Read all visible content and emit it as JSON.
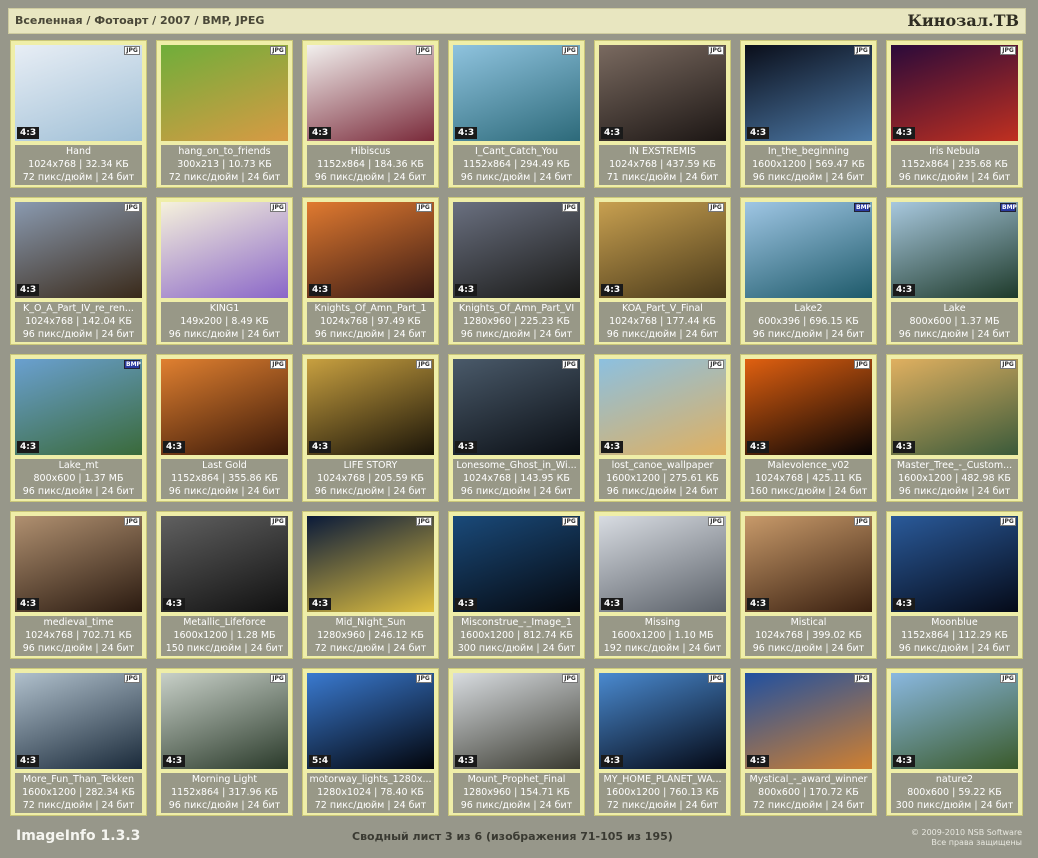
{
  "header": {
    "breadcrumb": "Вселенная / Фотоарт / 2007 / BMP, JPEG",
    "brand": "Кинозал.ТВ"
  },
  "footer": {
    "app_name": "ImageInfo 1.3.3",
    "sheet_info": "Сводный лист 3 из 6 (изображения 71-105 из 195)",
    "copyright": "© 2009-2010 NSB Software",
    "rights": "Все права защищены"
  },
  "items": [
    {
      "name": "Hand",
      "dims": "1024x768 | 32.34 КБ",
      "meta": "72 пикс/дюйм | 24 бит",
      "ratio": "4:3",
      "format": "JPG",
      "colors": [
        "#e8eef5",
        "#9fbfd6"
      ]
    },
    {
      "name": "hang_on_to_friends",
      "dims": "300x213 | 10.73 КБ",
      "meta": "72 пикс/дюйм | 24 бит",
      "ratio": "",
      "format": "JPG",
      "colors": [
        "#6fae3a",
        "#d89a44"
      ]
    },
    {
      "name": "Hibiscus",
      "dims": "1152x864 | 184.36 КБ",
      "meta": "96 пикс/дюйм | 24 бит",
      "ratio": "4:3",
      "format": "JPG",
      "colors": [
        "#f2f0ee",
        "#7a2a3a"
      ]
    },
    {
      "name": "I_Cant_Catch_You",
      "dims": "1152x864 | 294.49 КБ",
      "meta": "96 пикс/дюйм | 24 бит",
      "ratio": "4:3",
      "format": "JPG",
      "colors": [
        "#8fc3de",
        "#2d6a7a"
      ]
    },
    {
      "name": "IN EXSTREMIS",
      "dims": "1024x768 | 437.59 КБ",
      "meta": "71 пикс/дюйм | 24 бит",
      "ratio": "4:3",
      "format": "JPG",
      "colors": [
        "#7a6a60",
        "#1c1614"
      ]
    },
    {
      "name": "In_the_beginning",
      "dims": "1600x1200 | 569.47 КБ",
      "meta": "96 пикс/дюйм | 24 бит",
      "ratio": "4:3",
      "format": "JPG",
      "colors": [
        "#0a0e1a",
        "#4d7aa8"
      ]
    },
    {
      "name": "Iris Nebula",
      "dims": "1152x864 | 235.68 КБ",
      "meta": "96 пикс/дюйм | 24 бит",
      "ratio": "4:3",
      "format": "JPG",
      "colors": [
        "#2a0a3a",
        "#c03020"
      ]
    },
    {
      "name": "K_O_A_Part_IV_re_ren...",
      "dims": "1024x768 | 142.04 КБ",
      "meta": "96 пикс/дюйм | 24 бит",
      "ratio": "4:3",
      "format": "JPG",
      "colors": [
        "#8a9ab0",
        "#3a2a1a"
      ]
    },
    {
      "name": "KING1",
      "dims": "149x200 | 8.49 КБ",
      "meta": "96 пикс/дюйм | 24 бит",
      "ratio": "",
      "format": "JPG",
      "colors": [
        "#f6f2dc",
        "#8a66c8"
      ]
    },
    {
      "name": "Knights_Of_Amn_Part_1",
      "dims": "1024x768 | 97.49 КБ",
      "meta": "96 пикс/дюйм | 24 бит",
      "ratio": "4:3",
      "format": "JPG",
      "colors": [
        "#e07a30",
        "#3a1a14"
      ]
    },
    {
      "name": "Knights_Of_Amn_Part_VI",
      "dims": "1280x960 | 225.23 КБ",
      "meta": "96 пикс/дюйм | 24 бит",
      "ratio": "4:3",
      "format": "JPG",
      "colors": [
        "#6a7080",
        "#1a1a18"
      ]
    },
    {
      "name": "KOA_Part_V_Final",
      "dims": "1024x768 | 177.44 КБ",
      "meta": "96 пикс/дюйм | 24 бит",
      "ratio": "4:3",
      "format": "JPG",
      "colors": [
        "#c8a050",
        "#4a3a1a"
      ]
    },
    {
      "name": "Lake2",
      "dims": "600x396 | 696.15 КБ",
      "meta": "96 пикс/дюйм | 24 бит",
      "ratio": "",
      "format": "BMP",
      "colors": [
        "#9fc6e4",
        "#1e5a6a"
      ]
    },
    {
      "name": "Lake",
      "dims": "800x600 | 1.37 МБ",
      "meta": "96 пикс/дюйм | 24 бит",
      "ratio": "4:3",
      "format": "BMP",
      "colors": [
        "#a8c8de",
        "#1e3a2a"
      ]
    },
    {
      "name": "Lake_mt",
      "dims": "800x600 | 1.37 МБ",
      "meta": "96 пикс/дюйм | 24 бит",
      "ratio": "4:3",
      "format": "BMP",
      "colors": [
        "#6aa0d0",
        "#3a6a3a"
      ]
    },
    {
      "name": "Last Gold",
      "dims": "1152x864 | 355.86 КБ",
      "meta": "96 пикс/дюйм | 24 бит",
      "ratio": "4:3",
      "format": "JPG",
      "colors": [
        "#e08030",
        "#3a1808"
      ]
    },
    {
      "name": "LIFE STORY",
      "dims": "1024x768 | 205.59 КБ",
      "meta": "96 пикс/дюйм | 24 бит",
      "ratio": "4:3",
      "format": "JPG",
      "colors": [
        "#c8a040",
        "#1a1408"
      ]
    },
    {
      "name": "Lonesome_Ghost_in_Wi...",
      "dims": "1024x768 | 143.95 КБ",
      "meta": "96 пикс/дюйм | 24 бит",
      "ratio": "4:3",
      "format": "JPG",
      "colors": [
        "#4a5a6a",
        "#0a0e14"
      ]
    },
    {
      "name": "lost_canoe_wallpaper",
      "dims": "1600x1200 | 275.61 КБ",
      "meta": "96 пикс/дюйм | 24 бит",
      "ratio": "4:3",
      "format": "JPG",
      "colors": [
        "#8cc0e0",
        "#e0b060"
      ]
    },
    {
      "name": "Malevolence_v02",
      "dims": "1024x768 | 425.11 КБ",
      "meta": "160 пикс/дюйм | 24 бит",
      "ratio": "4:3",
      "format": "JPG",
      "colors": [
        "#e06010",
        "#080404"
      ]
    },
    {
      "name": "Master_Tree_-_Custom...",
      "dims": "1600x1200 | 482.98 КБ",
      "meta": "96 пикс/дюйм | 24 бит",
      "ratio": "4:3",
      "format": "JPG",
      "colors": [
        "#e0b060",
        "#3a5a3a"
      ]
    },
    {
      "name": "medieval_time",
      "dims": "1024x768 | 702.71 КБ",
      "meta": "96 пикс/дюйм | 24 бит",
      "ratio": "4:3",
      "format": "JPG",
      "colors": [
        "#b09070",
        "#2a1a10"
      ]
    },
    {
      "name": "Metallic_Lifeforce",
      "dims": "1600x1200 | 1.28 МБ",
      "meta": "150 пикс/дюйм | 24 бит",
      "ratio": "4:3",
      "format": "JPG",
      "colors": [
        "#606060",
        "#101010"
      ]
    },
    {
      "name": "Mid_Night_Sun",
      "dims": "1280x960 | 246.12 КБ",
      "meta": "72 пикс/дюйм | 24 бит",
      "ratio": "4:3",
      "format": "JPG",
      "colors": [
        "#0a1a3a",
        "#e0c040"
      ]
    },
    {
      "name": "Misconstrue_-_Image_1",
      "dims": "1600x1200 | 812.74 КБ",
      "meta": "300 пикс/дюйм | 24 бит",
      "ratio": "4:3",
      "format": "JPG",
      "colors": [
        "#1a4a7a",
        "#05080e"
      ]
    },
    {
      "name": "Missing",
      "dims": "1600x1200 | 1.10 МБ",
      "meta": "192 пикс/дюйм | 24 бит",
      "ratio": "4:3",
      "format": "JPG",
      "colors": [
        "#d8dce2",
        "#5a6068"
      ]
    },
    {
      "name": "Mistical",
      "dims": "1024x768 | 399.02 КБ",
      "meta": "96 пикс/дюйм | 24 бит",
      "ratio": "4:3",
      "format": "JPG",
      "colors": [
        "#c89a6a",
        "#3a2010"
      ]
    },
    {
      "name": "Moonblue",
      "dims": "1152x864 | 112.29 КБ",
      "meta": "96 пикс/дюйм | 24 бит",
      "ratio": "4:3",
      "format": "JPG",
      "colors": [
        "#2a5a9a",
        "#050a18"
      ]
    },
    {
      "name": "More_Fun_Than_Tekken",
      "dims": "1600x1200 | 282.34 КБ",
      "meta": "72 пикс/дюйм | 24 бит",
      "ratio": "4:3",
      "format": "JPG",
      "colors": [
        "#b0c0cc",
        "#1a2a3a"
      ]
    },
    {
      "name": "Morning Light",
      "dims": "1152x864 | 317.96 КБ",
      "meta": "96 пикс/дюйм | 24 бит",
      "ratio": "4:3",
      "format": "JPG",
      "colors": [
        "#c8d0c8",
        "#2a3a2a"
      ]
    },
    {
      "name": "motorway_lights_1280x...",
      "dims": "1280x1024 | 78.40 КБ",
      "meta": "72 пикс/дюйм | 24 бит",
      "ratio": "5:4",
      "format": "JPG",
      "colors": [
        "#3a7ad0",
        "#02040a"
      ]
    },
    {
      "name": "Mount_Prophet_Final",
      "dims": "1280x960 | 154.71 КБ",
      "meta": "96 пикс/дюйм | 24 бит",
      "ratio": "4:3",
      "format": "JPG",
      "colors": [
        "#d8dce0",
        "#3a3a30"
      ]
    },
    {
      "name": "MY_HOME_PLANET_WA...",
      "dims": "1600x1200 | 760.13 КБ",
      "meta": "72 пикс/дюйм | 24 бит",
      "ratio": "4:3",
      "format": "JPG",
      "colors": [
        "#4a8ad0",
        "#040814"
      ]
    },
    {
      "name": "Mystical_-_award_winner",
      "dims": "800x600 | 170.72 КБ",
      "meta": "72 пикс/дюйм | 24 бит",
      "ratio": "4:3",
      "format": "JPG",
      "colors": [
        "#2050a0",
        "#d08030"
      ]
    },
    {
      "name": "nature2",
      "dims": "800x600 | 59.22 КБ",
      "meta": "300 пикс/дюйм | 24 бит",
      "ratio": "4:3",
      "format": "JPG",
      "colors": [
        "#8ab8e0",
        "#3a5a2a"
      ]
    }
  ]
}
